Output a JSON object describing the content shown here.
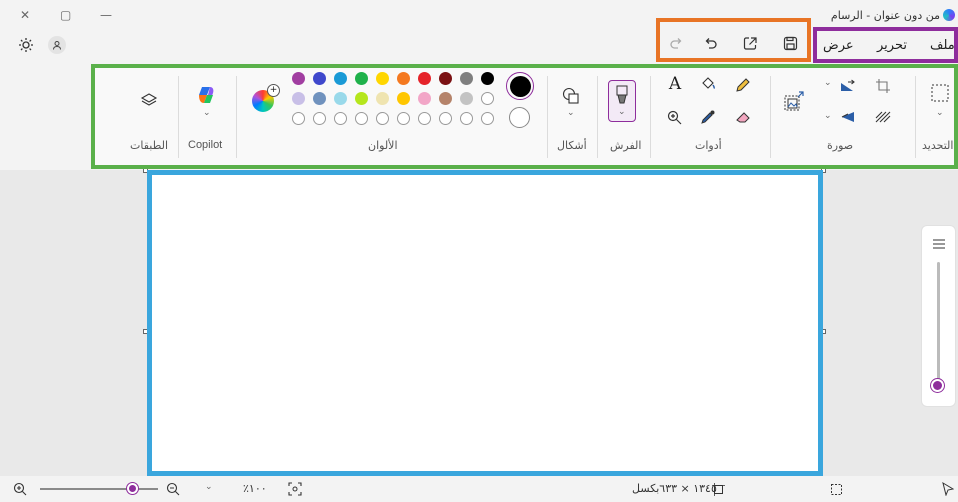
{
  "app": {
    "title": "من دون عنوان - الرسام",
    "window_controls": {
      "minimize": "—",
      "maximize": "▢",
      "close": "✕"
    }
  },
  "menu": {
    "items": [
      {
        "label": "ملف"
      },
      {
        "label": "تحرير"
      },
      {
        "label": "عرض"
      }
    ]
  },
  "quick_actions": {
    "icons": [
      "save-icon",
      "share-icon",
      "undo-icon",
      "redo-icon"
    ]
  },
  "ribbon": {
    "groups": {
      "selection": "التحديد",
      "image": "صورة",
      "tools": "أدوات",
      "brushes": "الفرش",
      "shapes": "أشكال",
      "colors": "الألوان",
      "copilot": "Copilot",
      "layers": "الطبقات"
    },
    "tool_text_glyph": "A",
    "colors": {
      "row1": [
        "#000000",
        "#7f7f7f",
        "#7b1113",
        "#e5232a",
        "#f47920",
        "#ffd600",
        "#1fb14b",
        "#1a9ad6",
        "#3f48cc",
        "#a13ea1"
      ],
      "row2": [
        "#ffffff",
        "#c3c3c3",
        "#b5836a",
        "#f2a6c7",
        "#ffc600",
        "#efe4b0",
        "#b5e61d",
        "#99d9ea",
        "#7092be",
        "#c8bfe7"
      ],
      "primary": "#000000",
      "secondary": "#ffffff"
    }
  },
  "status": {
    "canvas_size": "١٣٤٥ × ٦٣٣بكسل",
    "zoom": "٪١٠٠",
    "zoom_fraction": 0.78
  },
  "frame_colors": {
    "orange": "#e87425",
    "purple": "#8e2d9c",
    "green": "#5ab04a",
    "blue": "#3aa6dd"
  }
}
